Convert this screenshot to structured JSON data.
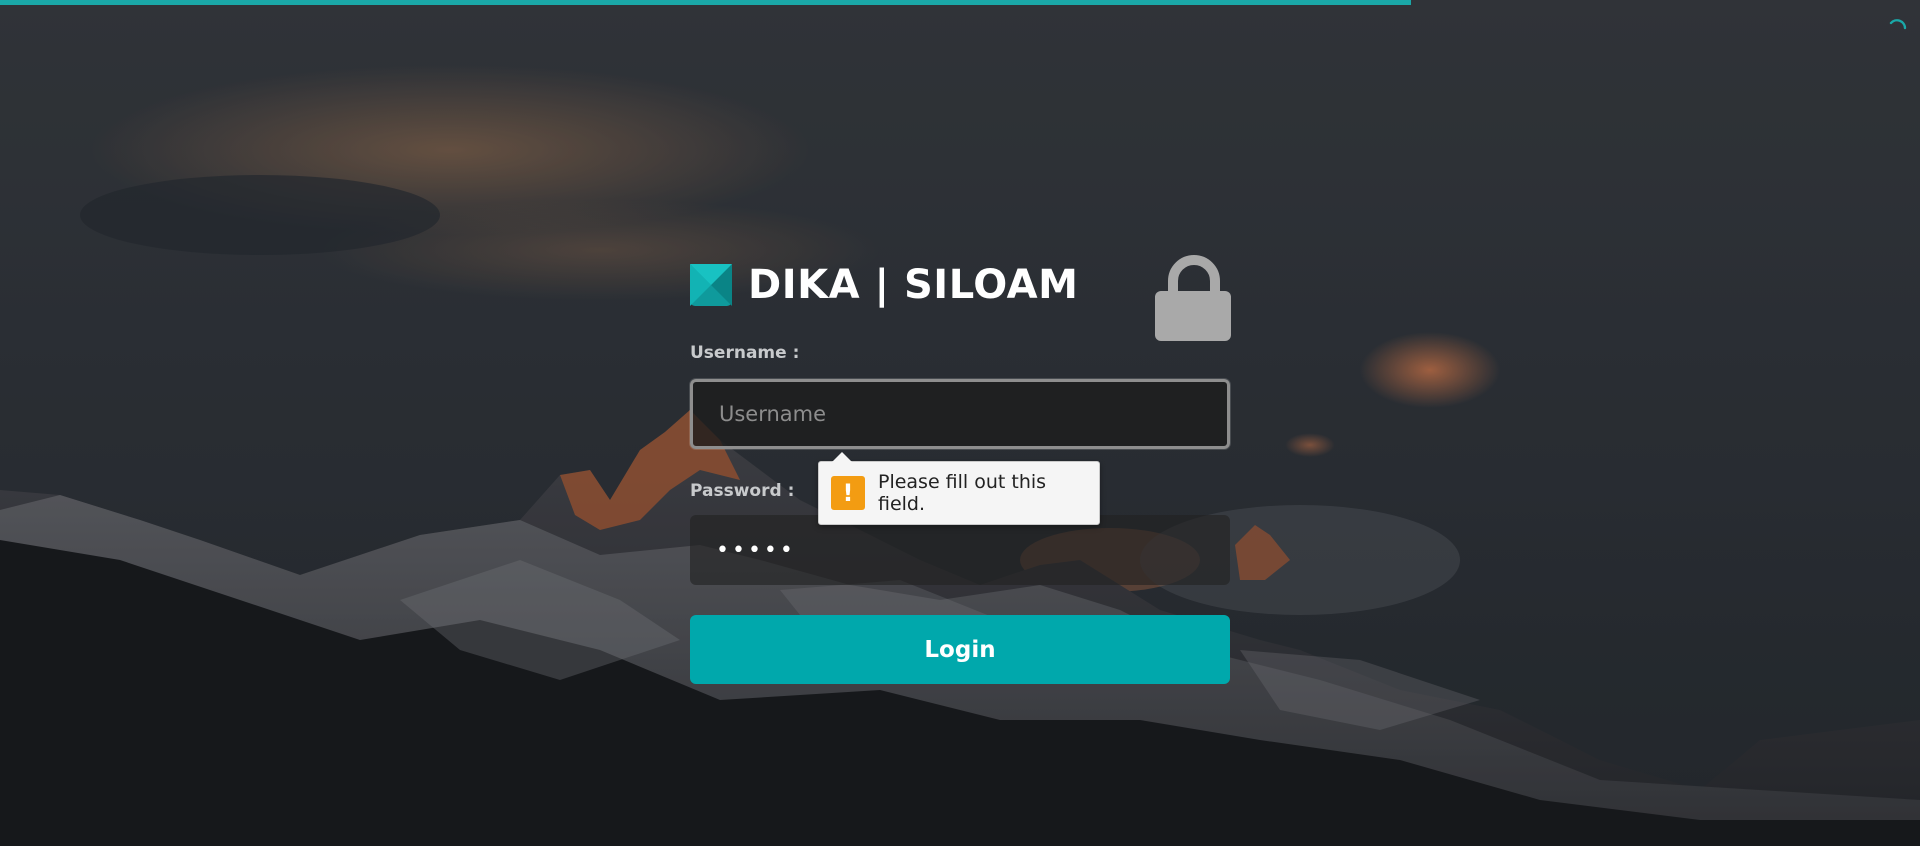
{
  "loading": {
    "progress": 0.735,
    "progress_color": "#1aa8a8"
  },
  "brand": {
    "title": "DIKA | SILOAM",
    "logo_icon": "dika-logo-icon",
    "lock_icon": "lock-icon"
  },
  "form": {
    "username_label": "Username :",
    "username_placeholder": "Username",
    "username_value": "",
    "password_label": "Password :",
    "password_value": "•••••",
    "login_label": "Login"
  },
  "validation": {
    "message": "Please fill out this field.",
    "icon": "warning-icon",
    "icon_glyph": "!"
  },
  "colors": {
    "accent": "#00a8ac",
    "warning": "#f39c12"
  }
}
